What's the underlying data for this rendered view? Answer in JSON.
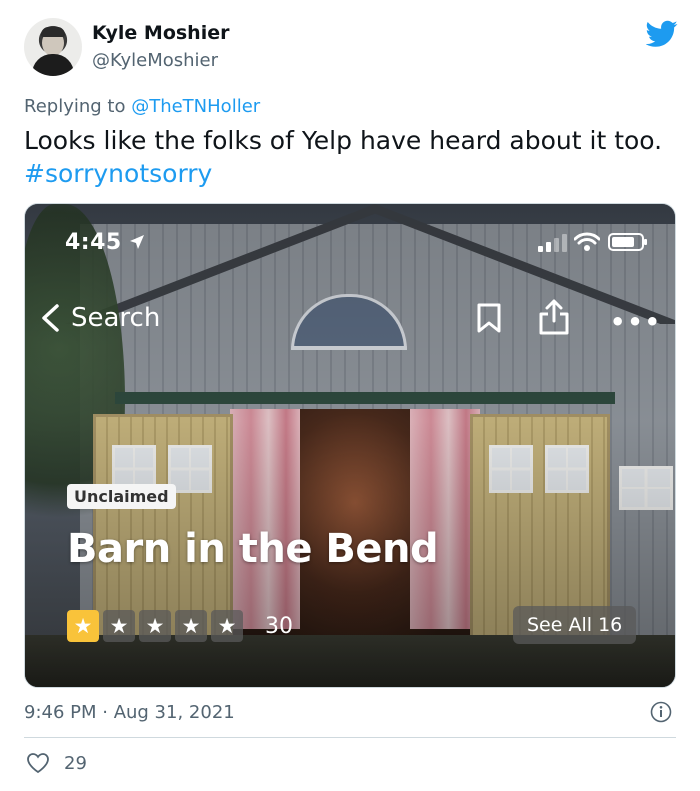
{
  "tweet": {
    "author_name": "Kyle Moshier",
    "author_handle": "@KyleMoshier",
    "replying_prefix": "Replying to ",
    "replying_to": "@TheTNHoller",
    "text": "Looks like the folks of Yelp have heard about it too.",
    "hashtag": "#sorrynotsorry",
    "timestamp": "9:46 PM · Aug 31, 2021",
    "like_count": "29"
  },
  "screenshot": {
    "status_time": "4:45",
    "back_label": "Search",
    "badge": "Unclaimed",
    "business_name": "Barn in the Bend",
    "review_count": "30",
    "see_all": "See All 16",
    "rating_stars": 1,
    "star_total": 5
  },
  "colors": {
    "twitter_blue": "#1d9bf0",
    "yelp_star": "#f9c33a",
    "secondary_text": "#536471"
  },
  "icons": [
    "twitter-bird-icon",
    "location-arrow-icon",
    "signal-icon",
    "wifi-icon",
    "battery-icon",
    "back-chevron-icon",
    "bookmark-icon",
    "share-icon",
    "more-icon",
    "star-icon",
    "info-icon",
    "heart-icon"
  ]
}
